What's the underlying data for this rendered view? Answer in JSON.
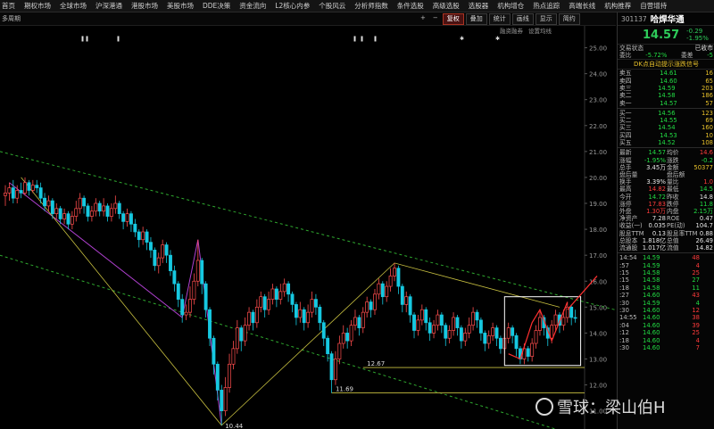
{
  "nav": [
    "首页",
    "期权市场",
    "全球市场",
    "沪深港通",
    "港股市场",
    "美股市场",
    "DDE决策",
    "资金流向",
    "L2核心内参",
    "个股风云",
    "分析师指数",
    "条件选股",
    "高级选股",
    "选股器",
    "机构增仓",
    "热点追踪",
    "高端长线",
    "机构推荐",
    "自营增持"
  ],
  "toolbar": {
    "left_label": "多周期",
    "buttons": [
      {
        "label": "+",
        "active": false,
        "sym": true
      },
      {
        "label": "−",
        "active": false,
        "sym": true
      },
      {
        "label": "复权",
        "active": true,
        "sym": false
      },
      {
        "label": "叠加",
        "active": false,
        "sym": false
      },
      {
        "label": "统计",
        "active": false,
        "sym": false
      },
      {
        "label": "画线",
        "active": false,
        "sym": false
      },
      {
        "label": "显示",
        "active": false,
        "sym": false
      },
      {
        "label": "简约",
        "active": false,
        "sym": false
      }
    ]
  },
  "subbar": [
    "融资融券",
    "设置均线"
  ],
  "chart_data": {
    "type": "candlestick",
    "y_ticks": [
      "25.00",
      "24.00",
      "23.00",
      "22.00",
      "21.00",
      "20.00",
      "19.00",
      "18.00",
      "17.00",
      "16.00",
      "15.00",
      "14.00",
      "13.00",
      "12.00",
      "11.00"
    ],
    "ylim": [
      10.3,
      25.5
    ],
    "annotations": [
      {
        "label": "10.44",
        "value": 10.44
      },
      {
        "label": "11.69",
        "value": 11.69
      },
      {
        "label": "12.67",
        "value": 12.67
      }
    ],
    "candles": [
      [
        0,
        19.3,
        19.4,
        19.7,
        18.9
      ],
      [
        1,
        19.4,
        19.6,
        19.8,
        19.1
      ],
      [
        2,
        19.6,
        19.2,
        19.9,
        19.0
      ],
      [
        3,
        19.2,
        19.5,
        19.7,
        19.0
      ],
      [
        4,
        19.5,
        19.4,
        19.8,
        19.2
      ],
      [
        5,
        19.4,
        19.8,
        20.0,
        19.3
      ],
      [
        6,
        19.8,
        19.5,
        19.9,
        19.3
      ],
      [
        7,
        19.5,
        19.7,
        19.9,
        19.4
      ],
      [
        8,
        19.7,
        19.6,
        19.9,
        19.4
      ],
      [
        9,
        19.6,
        19.2,
        19.8,
        19.0
      ],
      [
        10,
        19.2,
        18.9,
        19.4,
        18.7
      ],
      [
        11,
        18.9,
        19.1,
        19.3,
        18.7
      ],
      [
        12,
        19.1,
        18.6,
        19.2,
        18.4
      ],
      [
        13,
        18.6,
        18.8,
        19.0,
        18.4
      ],
      [
        14,
        18.8,
        18.4,
        18.9,
        18.2
      ],
      [
        15,
        18.4,
        18.6,
        18.8,
        18.2
      ],
      [
        16,
        18.6,
        18.2,
        18.7,
        18.0
      ],
      [
        17,
        18.2,
        18.5,
        18.7,
        18.0
      ],
      [
        18,
        18.5,
        18.8,
        19.1,
        18.3
      ],
      [
        19,
        18.8,
        19.2,
        19.4,
        18.6
      ],
      [
        20,
        19.2,
        18.9,
        19.3,
        18.6
      ],
      [
        21,
        18.9,
        18.5,
        19.0,
        18.3
      ],
      [
        22,
        18.5,
        18.7,
        18.9,
        18.3
      ],
      [
        23,
        18.7,
        19.0,
        19.2,
        18.5
      ],
      [
        24,
        19.0,
        18.7,
        19.1,
        18.5
      ],
      [
        25,
        18.7,
        18.9,
        19.2,
        18.5
      ],
      [
        26,
        18.9,
        18.5,
        19.0,
        18.3
      ],
      [
        27,
        18.5,
        18.8,
        19.0,
        18.3
      ],
      [
        28,
        18.8,
        19.0,
        19.3,
        18.6
      ],
      [
        29,
        19.0,
        18.6,
        19.1,
        18.4
      ],
      [
        30,
        18.6,
        18.3,
        18.7,
        18.0
      ],
      [
        31,
        18.3,
        18.6,
        18.8,
        18.1
      ],
      [
        32,
        18.6,
        18.2,
        18.7,
        17.9
      ],
      [
        33,
        18.2,
        17.9,
        18.4,
        17.7
      ],
      [
        34,
        17.9,
        17.6,
        18.0,
        17.3
      ],
      [
        35,
        17.6,
        17.9,
        18.1,
        17.4
      ],
      [
        36,
        17.9,
        17.5,
        18.0,
        17.2
      ],
      [
        37,
        17.5,
        17.2,
        17.7,
        16.9
      ],
      [
        38,
        17.2,
        16.6,
        17.3,
        16.4
      ],
      [
        39,
        16.6,
        16.9,
        17.1,
        16.3
      ],
      [
        40,
        16.9,
        17.4,
        17.6,
        16.7
      ],
      [
        41,
        17.4,
        17.0,
        17.5,
        16.7
      ],
      [
        42,
        17.0,
        16.4,
        17.2,
        16.2
      ],
      [
        43,
        16.4,
        15.9,
        16.6,
        15.6
      ],
      [
        44,
        15.9,
        15.3,
        16.0,
        15.0
      ],
      [
        45,
        15.3,
        14.7,
        15.5,
        14.4
      ],
      [
        46,
        14.7,
        14.8,
        15.1,
        14.5
      ],
      [
        47,
        14.8,
        15.3,
        15.8,
        14.6
      ],
      [
        48,
        15.3,
        16.0,
        16.3,
        15.1
      ],
      [
        49,
        16.0,
        16.8,
        17.6,
        15.8
      ],
      [
        50,
        16.8,
        15.9,
        16.9,
        15.5
      ],
      [
        51,
        15.9,
        14.9,
        16.0,
        14.6
      ],
      [
        52,
        14.9,
        13.8,
        15.0,
        13.5
      ],
      [
        53,
        13.8,
        12.8,
        13.9,
        12.4
      ],
      [
        54,
        12.8,
        11.8,
        12.9,
        11.4
      ],
      [
        55,
        11.8,
        11.0,
        12.0,
        10.44
      ],
      [
        56,
        11.0,
        11.9,
        12.3,
        10.8
      ],
      [
        57,
        11.9,
        12.8,
        13.2,
        11.7
      ],
      [
        58,
        12.8,
        13.4,
        13.7,
        12.6
      ],
      [
        59,
        13.4,
        14.2,
        14.5,
        13.2
      ],
      [
        60,
        14.2,
        13.7,
        14.3,
        13.3
      ],
      [
        61,
        13.7,
        14.3,
        14.6,
        13.5
      ],
      [
        62,
        14.3,
        14.8,
        15.0,
        14.1
      ],
      [
        63,
        14.8,
        14.4,
        14.9,
        14.1
      ],
      [
        64,
        14.4,
        15.0,
        15.3,
        14.2
      ],
      [
        65,
        15.0,
        15.4,
        15.6,
        14.8
      ],
      [
        66,
        15.4,
        14.9,
        15.5,
        14.6
      ],
      [
        67,
        14.9,
        15.3,
        15.6,
        14.7
      ],
      [
        68,
        15.3,
        15.7,
        15.9,
        15.1
      ],
      [
        69,
        15.7,
        15.3,
        15.8,
        15.0
      ],
      [
        70,
        15.3,
        15.6,
        15.9,
        15.1
      ],
      [
        71,
        15.6,
        15.9,
        16.1,
        15.4
      ],
      [
        72,
        15.9,
        15.5,
        16.0,
        15.2
      ],
      [
        73,
        15.5,
        15.1,
        15.6,
        14.8
      ],
      [
        74,
        15.1,
        14.6,
        15.2,
        14.3
      ],
      [
        75,
        14.6,
        14.9,
        15.2,
        14.4
      ],
      [
        76,
        14.9,
        14.4,
        15.0,
        14.1
      ],
      [
        77,
        14.4,
        14.8,
        15.1,
        14.2
      ],
      [
        78,
        14.8,
        15.3,
        15.6,
        14.6
      ],
      [
        79,
        15.3,
        15.0,
        15.5,
        14.7
      ],
      [
        80,
        15.0,
        14.4,
        15.1,
        14.1
      ],
      [
        81,
        14.4,
        13.8,
        14.5,
        13.5
      ],
      [
        82,
        13.8,
        13.2,
        13.9,
        12.9
      ],
      [
        83,
        13.2,
        12.2,
        13.3,
        11.69
      ],
      [
        84,
        12.2,
        13.0,
        13.3,
        12.0
      ],
      [
        85,
        13.0,
        13.6,
        13.9,
        12.8
      ],
      [
        86,
        13.6,
        14.0,
        14.3,
        13.4
      ],
      [
        87,
        14.0,
        13.7,
        14.2,
        13.4
      ],
      [
        88,
        13.7,
        14.3,
        14.5,
        13.5
      ],
      [
        89,
        14.3,
        14.6,
        14.9,
        14.1
      ],
      [
        90,
        14.6,
        14.2,
        14.7,
        13.9
      ],
      [
        91,
        14.2,
        14.8,
        15.0,
        14.0
      ],
      [
        92,
        14.8,
        15.2,
        15.4,
        14.6
      ],
      [
        93,
        15.2,
        14.9,
        15.3,
        14.6
      ],
      [
        94,
        14.9,
        15.5,
        15.7,
        14.7
      ],
      [
        95,
        15.5,
        15.9,
        16.1,
        15.3
      ],
      [
        96,
        15.9,
        15.4,
        16.0,
        15.1
      ],
      [
        97,
        15.4,
        15.8,
        16.0,
        15.2
      ],
      [
        98,
        15.8,
        16.2,
        16.5,
        15.6
      ],
      [
        99,
        16.2,
        16.5,
        16.7,
        16.0
      ],
      [
        100,
        16.5,
        15.8,
        16.6,
        15.5
      ],
      [
        101,
        15.8,
        15.1,
        15.9,
        14.8
      ],
      [
        102,
        15.1,
        15.4,
        15.6,
        14.8
      ],
      [
        103,
        15.4,
        14.7,
        15.5,
        14.4
      ],
      [
        104,
        14.7,
        14.1,
        14.8,
        13.8
      ],
      [
        105,
        14.1,
        14.5,
        14.7,
        13.9
      ],
      [
        106,
        14.5,
        14.9,
        15.1,
        14.3
      ],
      [
        107,
        14.9,
        14.4,
        15.0,
        14.1
      ],
      [
        108,
        14.4,
        14.0,
        14.6,
        13.7
      ],
      [
        109,
        14.0,
        14.3,
        14.5,
        13.8
      ],
      [
        110,
        14.3,
        14.7,
        14.9,
        14.1
      ],
      [
        111,
        14.7,
        14.3,
        14.8,
        14.0
      ],
      [
        112,
        14.3,
        13.8,
        14.4,
        13.5
      ],
      [
        113,
        13.8,
        14.1,
        14.3,
        13.6
      ],
      [
        114,
        14.1,
        14.6,
        14.8,
        13.9
      ],
      [
        115,
        14.6,
        14.2,
        14.7,
        13.9
      ],
      [
        116,
        14.2,
        13.7,
        14.3,
        13.4
      ],
      [
        117,
        13.7,
        14.0,
        14.2,
        13.5
      ],
      [
        118,
        14.0,
        14.3,
        14.6,
        13.8
      ],
      [
        119,
        14.3,
        14.8,
        15.0,
        14.1
      ],
      [
        120,
        14.8,
        14.5,
        14.9,
        14.2
      ],
      [
        121,
        14.5,
        14.0,
        14.6,
        13.7
      ],
      [
        122,
        14.0,
        13.6,
        14.1,
        13.3
      ],
      [
        123,
        13.6,
        13.9,
        14.1,
        13.4
      ],
      [
        124,
        13.9,
        14.2,
        14.4,
        13.7
      ],
      [
        125,
        14.2,
        13.8,
        14.3,
        13.5
      ],
      [
        126,
        13.8,
        13.4,
        13.9,
        13.2
      ],
      [
        127,
        13.4,
        13.8,
        14.0,
        13.2
      ],
      [
        128,
        13.8,
        14.2,
        14.4,
        13.6
      ],
      [
        129,
        14.2,
        13.9,
        14.3,
        13.6
      ],
      [
        130,
        13.9,
        13.4,
        14.0,
        13.1
      ],
      [
        131,
        13.4,
        13.0,
        13.5,
        12.8
      ],
      [
        132,
        13.0,
        13.4,
        13.6,
        12.8
      ],
      [
        133,
        13.4,
        13.1,
        13.5,
        12.9
      ],
      [
        134,
        13.1,
        13.6,
        13.8,
        12.9
      ],
      [
        135,
        13.6,
        14.1,
        14.3,
        13.4
      ],
      [
        136,
        14.1,
        14.6,
        14.9,
        13.9
      ],
      [
        137,
        14.6,
        14.2,
        14.7,
        13.9
      ],
      [
        138,
        14.2,
        13.8,
        14.3,
        13.5
      ],
      [
        139,
        13.8,
        14.3,
        14.5,
        13.6
      ],
      [
        140,
        14.3,
        14.7,
        14.9,
        14.1
      ],
      [
        141,
        14.7,
        14.3,
        14.8,
        14.0
      ],
      [
        142,
        14.3,
        14.6,
        14.9,
        14.1
      ],
      [
        143,
        14.6,
        15.0,
        15.2,
        14.4
      ],
      [
        144,
        15.0,
        14.6,
        15.1,
        14.3
      ],
      [
        145,
        14.6,
        14.57,
        14.9,
        14.4
      ]
    ],
    "trend_lines": [
      "channel-upper",
      "channel-lower",
      "swing-lines",
      "support-lines"
    ]
  },
  "stock": {
    "code": "301137",
    "name": "哈焊华通",
    "price": "14.57",
    "change": "-0.29",
    "change_pct": "-1.95%"
  },
  "panel": {
    "status_label": "交易状态",
    "status_value": "已收市",
    "ratio_label": "委比",
    "ratio_value": "-5.72%",
    "diff_label": "委差",
    "diff_value": "-5",
    "dk_title": "DK点自动提示涨跌信号"
  },
  "orderbook": {
    "sells": [
      {
        "k": "卖五",
        "p": "14.61",
        "v": "16"
      },
      {
        "k": "卖四",
        "p": "14.60",
        "v": "65"
      },
      {
        "k": "卖三",
        "p": "14.59",
        "v": "203"
      },
      {
        "k": "卖二",
        "p": "14.58",
        "v": "186"
      },
      {
        "k": "卖一",
        "p": "14.57",
        "v": "57"
      }
    ],
    "buys": [
      {
        "k": "买一",
        "p": "14.56",
        "v": "123"
      },
      {
        "k": "买二",
        "p": "14.55",
        "v": "69"
      },
      {
        "k": "买三",
        "p": "14.54",
        "v": "160"
      },
      {
        "k": "买四",
        "p": "14.53",
        "v": "10"
      },
      {
        "k": "买五",
        "p": "14.52",
        "v": "108"
      }
    ]
  },
  "stats": [
    {
      "k1": "最新",
      "v1": "14.57",
      "c1": "g",
      "k2": "均价",
      "v2": "14.6",
      "c2": "rd"
    },
    {
      "k1": "涨幅",
      "v1": "-1.95%",
      "c1": "g",
      "k2": "涨跌",
      "v2": "-0.2",
      "c2": "g"
    },
    {
      "k1": "总手",
      "v1": "3.45万",
      "c1": "w",
      "k2": "金额",
      "v2": "50377",
      "c2": "y"
    },
    {
      "k1": "盘后量",
      "v1": "",
      "c1": "w",
      "k2": "盘后额",
      "v2": "",
      "c2": "w"
    },
    {
      "k1": "换手",
      "v1": "3.39%",
      "c1": "w",
      "k2": "量比",
      "v2": "1.0",
      "c2": "rd"
    },
    {
      "k1": "最高",
      "v1": "14.82",
      "c1": "rd",
      "k2": "最低",
      "v2": "14.5",
      "c2": "g"
    },
    {
      "k1": "今开",
      "v1": "14.72",
      "c1": "g",
      "k2": "昨收",
      "v2": "14.8",
      "c2": "w"
    },
    {
      "k1": "涨停",
      "v1": "17.83",
      "c1": "rd",
      "k2": "跌停",
      "v2": "11.8",
      "c2": "g"
    },
    {
      "k1": "外盘",
      "v1": "1.30万",
      "c1": "rd",
      "k2": "内盘",
      "v2": "2.15万",
      "c2": "g"
    },
    {
      "k1": "净资产",
      "v1": "7.28",
      "c1": "w",
      "k2": "ROE",
      "v2": "0.47",
      "c2": "w"
    },
    {
      "k1": "收益(一)",
      "v1": "0.035",
      "c1": "w",
      "k2": "PE(动)",
      "v2": "104.7",
      "c2": "w"
    },
    {
      "k1": "股息TTM",
      "v1": "0.13",
      "c1": "w",
      "k2": "股息率TTM",
      "v2": "0.88",
      "c2": "w"
    },
    {
      "k1": "总股本",
      "v1": "1.818亿",
      "c1": "w",
      "k2": "总值",
      "v2": "26.49",
      "c2": "w"
    },
    {
      "k1": "流通股",
      "v1": "1.017亿",
      "c1": "w",
      "k2": "流值",
      "v2": "14.82",
      "c2": "w"
    }
  ],
  "ticks": [
    {
      "t": "14:54",
      "p": "14.59",
      "pc": "g",
      "v": "48",
      "vc": "rd"
    },
    {
      "t": ":57",
      "p": "14.59",
      "pc": "g",
      "v": "4",
      "vc": "rd"
    },
    {
      "t": ":15",
      "p": "14.58",
      "pc": "g",
      "v": "25",
      "vc": "rd"
    },
    {
      "t": ":15",
      "p": "14.58",
      "pc": "g",
      "v": "27",
      "vc": "g"
    },
    {
      "t": ":18",
      "p": "14.58",
      "pc": "g",
      "v": "11",
      "vc": "g"
    },
    {
      "t": ":27",
      "p": "14.60",
      "pc": "g",
      "v": "43",
      "vc": "rd"
    },
    {
      "t": ":30",
      "p": "14.59",
      "pc": "g",
      "v": "4",
      "vc": "g"
    },
    {
      "t": ":30",
      "p": "14.60",
      "pc": "g",
      "v": "12",
      "vc": "rd"
    },
    {
      "t": "14:55",
      "p": "14.60",
      "pc": "g",
      "v": "38",
      "vc": "rd"
    },
    {
      "t": ":04",
      "p": "14.60",
      "pc": "g",
      "v": "39",
      "vc": "rd"
    },
    {
      "t": ":12",
      "p": "14.60",
      "pc": "g",
      "v": "25",
      "vc": "rd"
    },
    {
      "t": ":18",
      "p": "14.60",
      "pc": "g",
      "v": "4",
      "vc": "rd"
    },
    {
      "t": ":30",
      "p": "14.60",
      "pc": "g",
      "v": "7",
      "vc": "rd"
    }
  ],
  "watermark": {
    "text": "雪球：梁山伯H"
  }
}
